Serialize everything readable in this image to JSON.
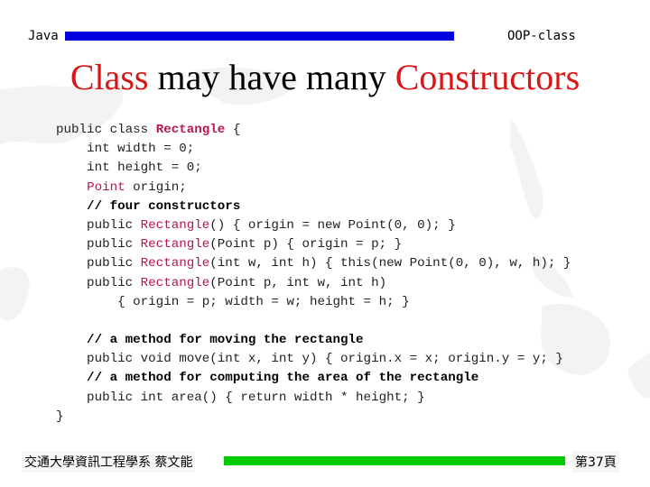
{
  "header": {
    "left_label": "Java",
    "right_label": "OOP-class",
    "bar_color": "#0000dd"
  },
  "title": {
    "part1": "Class",
    "part2": " may have many ",
    "part3": "Constructors",
    "accent_color": "#d81818"
  },
  "code": {
    "l1_a": "public class ",
    "l1_b": "Rectangle",
    "l1_c": " {",
    "l2": "    int width = 0;",
    "l3": "    int height = 0;",
    "l4_a": "    ",
    "l4_b": "Point",
    "l4_c": " origin;",
    "l5": "    // four constructors",
    "l6_a": "    public ",
    "l6_b": "Rectangle",
    "l6_c": "() { origin = new Point(0, 0); }",
    "l7_a": "    public ",
    "l7_b": "Rectangle",
    "l7_c": "(Point p) { origin = p; }",
    "l8_a": "    public ",
    "l8_b": "Rectangle",
    "l8_c": "(int w, int h) { this(new Point(0, 0), w, h); }",
    "l9_a": "    public ",
    "l9_b": "Rectangle",
    "l9_c": "(Point p, int w, int h)",
    "l10": "        { origin = p; width = w; height = h; }",
    "l11": "",
    "l12": "    // a method for moving the rectangle",
    "l13": "    public void move(int x, int y) { origin.x = x; origin.y = y; }",
    "l14": "    // a method for computing the area of the rectangle",
    "l15": "    public int area() { return width * height; }",
    "l16": "}"
  },
  "footer": {
    "left_label": "交通大學資訊工程學系 蔡文能",
    "right_label": "第37頁",
    "bar_color": "#00cc00"
  }
}
